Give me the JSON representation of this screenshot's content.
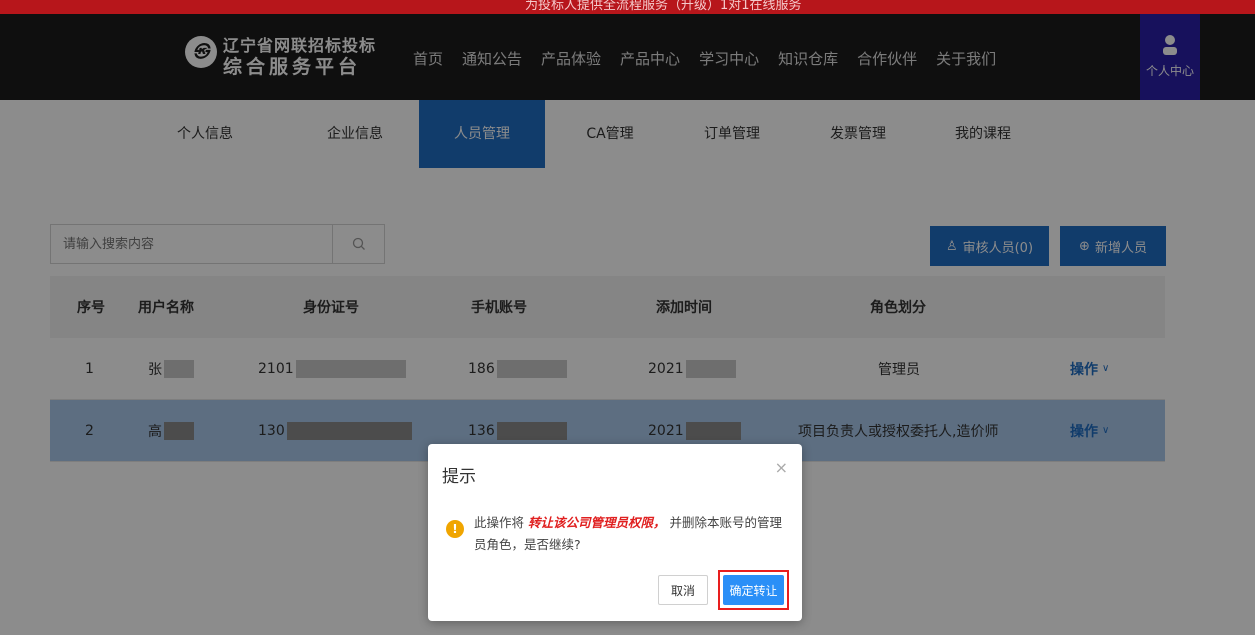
{
  "topbar": {
    "text": "为投标人提供全流程服务（升级）1对1在线服务"
  },
  "header": {
    "logo_line1": "辽宁省网联招标投标",
    "logo_line2": "综合服务平台",
    "nav": [
      "首页",
      "通知公告",
      "产品体验",
      "产品中心",
      "学习中心",
      "知识仓库",
      "合作伙伴",
      "关于我们"
    ],
    "profile_label": "个人中心"
  },
  "subnav": {
    "items": [
      "个人信息",
      "企业信息",
      "人员管理",
      "CA管理",
      "订单管理",
      "发票管理",
      "我的课程"
    ],
    "active": "人员管理"
  },
  "toolbar": {
    "search_placeholder": "请输入搜索内容",
    "audit_button": "审核人员(0)",
    "add_button": "新增人员"
  },
  "table": {
    "columns": [
      "序号",
      "用户名称",
      "身份证号",
      "手机账号",
      "添加时间",
      "角色划分"
    ],
    "rows": [
      {
        "no": "1",
        "name": "张",
        "id": "2101",
        "phone": "186",
        "time": "2021",
        "role": "管理员",
        "action": "操作"
      },
      {
        "no": "2",
        "name": "高",
        "id": "130",
        "phone": "136",
        "time": "2021",
        "role": "项目负责人或授权委托人,造价师",
        "action": "操作"
      }
    ]
  },
  "dialog": {
    "title": "提示",
    "close": "×",
    "icon": "!",
    "msg_prefix": "此操作将",
    "msg_emphasis": "转让该公司管理员权限，",
    "msg_suffix": "并删除本账号的管理员角色，是否继续?",
    "cancel": "取消",
    "confirm": "确定转让"
  },
  "colors": {
    "accent": "#1f6dc4",
    "banner": "#b7161b",
    "confirm_btn": "#2a8ff7",
    "highlight_border": "#e81e1e",
    "warning": "#f0a500"
  }
}
